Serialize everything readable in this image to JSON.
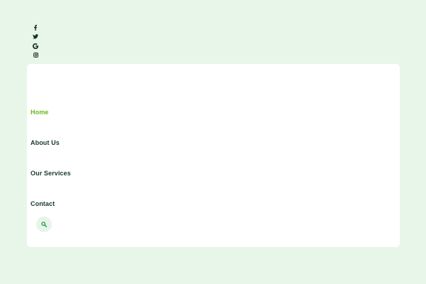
{
  "nav": {
    "items": [
      {
        "label": "Home",
        "active": true
      },
      {
        "label": "About Us",
        "active": false
      },
      {
        "label": "Our Services",
        "active": false
      },
      {
        "label": "Contact",
        "active": false
      }
    ]
  },
  "social": {
    "icons": [
      "facebook-icon",
      "twitter-icon",
      "google-icon",
      "instagram-icon"
    ]
  },
  "search": {
    "icon": "search-icon"
  },
  "colors": {
    "page_background": "#e8f5e9",
    "card_background": "#ffffff",
    "text_primary": "#173b2d",
    "accent_active": "#6bb61d",
    "search_button_background": "#e8f4e7",
    "search_icon": "#16a34a"
  }
}
